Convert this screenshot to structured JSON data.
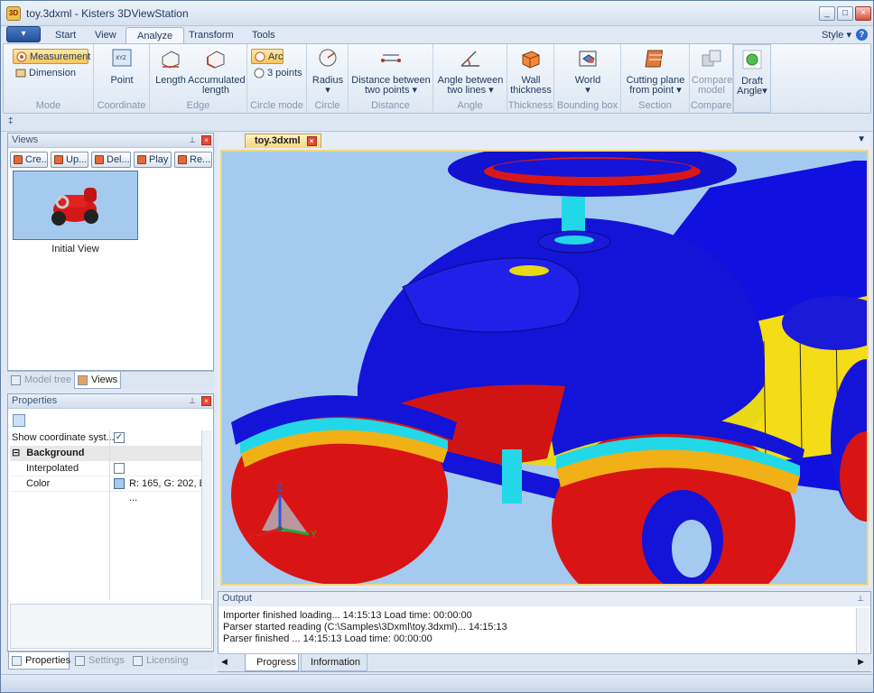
{
  "window": {
    "title": "toy.3dxml - Kisters 3DViewStation",
    "app_icon_text": "3D",
    "controls": [
      "minimize-icon",
      "maximize-icon",
      "close-icon"
    ]
  },
  "ribbon_tabs": [
    {
      "label": "Start"
    },
    {
      "label": "View"
    },
    {
      "label": "Analyze",
      "active": true
    },
    {
      "label": "Transform"
    },
    {
      "label": "Tools"
    }
  ],
  "style_menu": "Style",
  "help": "?",
  "ribbon": {
    "mode": {
      "measurement": "Measurement",
      "dimension": "Dimension",
      "label": "Mode"
    },
    "coordinate": {
      "point": "Point",
      "label": "Coordinate"
    },
    "edge": {
      "length": "Length",
      "accumulated_1": "Accumulated",
      "accumulated_2": "length",
      "label": "Edge"
    },
    "circle_mode": {
      "arc": "Arc",
      "three_points": "3 points",
      "label": "Circle mode"
    },
    "circle": {
      "radius": "Radius",
      "label": "Circle"
    },
    "distance": {
      "line1": "Distance between",
      "line2": "two points",
      "label": "Distance"
    },
    "angle": {
      "line1": "Angle between",
      "line2": "two lines",
      "label": "Angle"
    },
    "thickness": {
      "line1": "Wall",
      "line2": "thickness",
      "label": "Thickness"
    },
    "bounding_box": {
      "world": "World",
      "label": "Bounding box"
    },
    "section": {
      "line1": "Cutting plane",
      "line2": "from point",
      "label": "Section"
    },
    "compare": {
      "line1": "Compare",
      "line2": "model",
      "label": "Compare"
    },
    "draft": {
      "line1": "Draft",
      "line2": "Angle"
    }
  },
  "qat_symbol": "‡",
  "views_panel": {
    "title": "Views",
    "buttons": [
      "Cre...",
      "Up...",
      "Del...",
      "Play",
      "Re..."
    ],
    "thumbnail_label": "Initial View",
    "tabs": [
      {
        "label": "Model tree"
      },
      {
        "label": "Views",
        "active": true
      }
    ]
  },
  "properties_panel": {
    "title": "Properties",
    "show_coord": {
      "label": "Show coordinate syst...",
      "checked": true
    },
    "group": "Background",
    "interpolated": {
      "label": "Interpolated",
      "checked": false
    },
    "color": {
      "label": "Color",
      "value": "R: 165, G: 202, B: ...",
      "swatch": "#a5caf0"
    },
    "tabs": [
      {
        "label": "Properties",
        "active": true
      },
      {
        "label": "Settings"
      },
      {
        "label": "Licensing"
      }
    ]
  },
  "document": {
    "tab": "toy.3dxml",
    "axis": {
      "x": "X",
      "y": "Y",
      "z": "Z"
    }
  },
  "output": {
    "title": "Output",
    "lines": [
      "Importer finished loading... 14:15:13 Load time: 00:00:00",
      "Parser started reading (C:\\Samples\\3Dxml\\toy.3dxml)... 14:15:13",
      "Parser finished ... 14:15:13 Load time: 00:00:00"
    ],
    "tabs": [
      {
        "label": "Progress",
        "active": true
      },
      {
        "label": "Information"
      }
    ]
  },
  "colors": {
    "accent": "#f8c55b",
    "viewport_bg": "#a5caf0"
  }
}
